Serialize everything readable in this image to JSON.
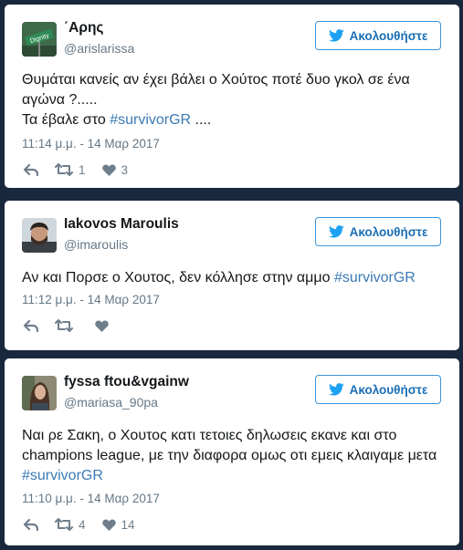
{
  "follow_label": "Ακολουθήστε",
  "colors": {
    "twitter_blue": "#1da1f2",
    "hashtag": "#3b7ab5",
    "background": "#19283c"
  },
  "tweets": [
    {
      "name": "΄Αρης",
      "handle": "@arislarissa",
      "avatar_label": "Dignity",
      "text_lines": [
        "Θυμάται κανείς αν έχει βάλει ο Χούτος ποτέ δυο γκολ σε ένα αγώνα ?....."
      ],
      "text_prefix": "Τα έβαλε στο ",
      "hashtag": "#survivorGR",
      "text_suffix": " ....",
      "timestamp": "11:14 μ.μ. - 14 Μαρ 2017",
      "retweets": "1",
      "likes": "3"
    },
    {
      "name": "Iakovos Maroulis",
      "handle": "@imaroulis",
      "text_prefix": "Αν και Πορσε ο Χουτος, δεν κόλλησε στην αμμο ",
      "hashtag": "#survivorGR",
      "timestamp": "11:12 μ.μ. - 14 Μαρ 2017",
      "retweets": "",
      "likes": ""
    },
    {
      "name": "fyssa ftou&vgainw",
      "handle": "@mariasa_90pa",
      "text_prefix": "Ναι ρε Σακη, ο Χουτος κατι τετοιες δηλωσεις εκανε και στο champions league, με την διαφορα ομως οτι εμεις κλαιγαμε μετα ",
      "hashtag": "#survivorGR",
      "timestamp": "11:10 μ.μ. - 14 Μαρ 2017",
      "retweets": "4",
      "likes": "14"
    }
  ]
}
